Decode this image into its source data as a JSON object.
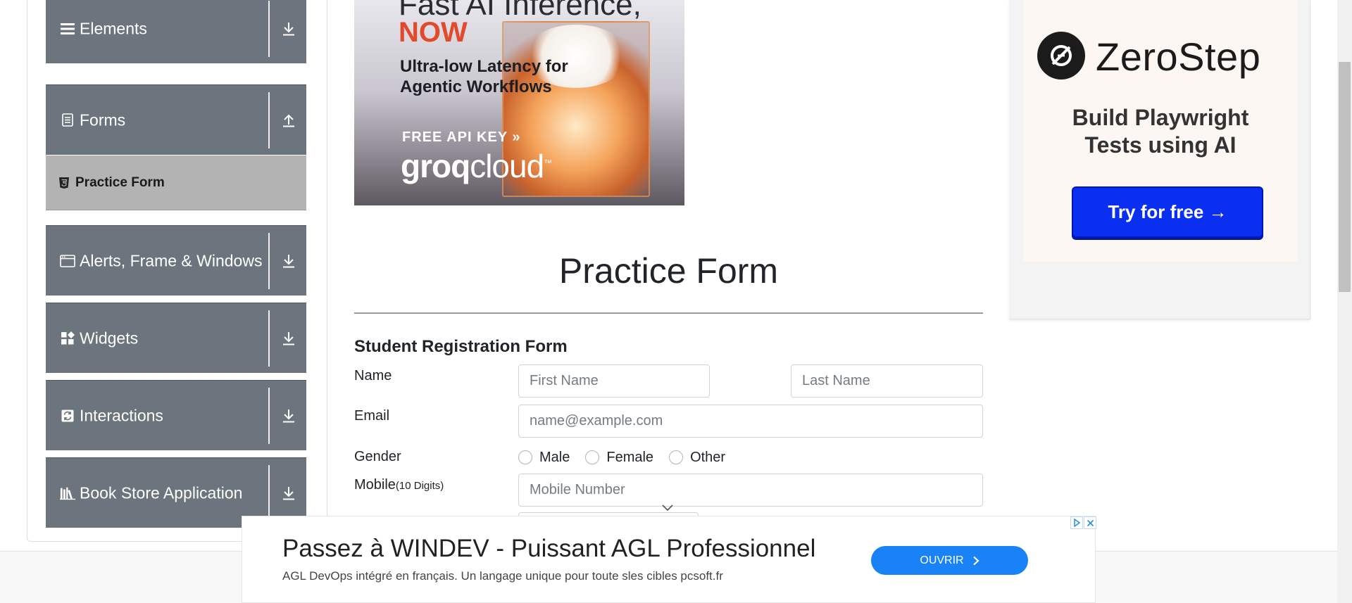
{
  "sidebar": {
    "groups": [
      {
        "label": "Elements",
        "icon": "hamburger-icon",
        "toggle_icon": "download-arrow-icon"
      },
      {
        "label": "Forms",
        "icon": "document-icon",
        "toggle_icon": "upload-arrow-icon"
      },
      {
        "label": "Alerts, Frame & Windows",
        "icon": "window-icon",
        "toggle_icon": "download-arrow-icon"
      },
      {
        "label": "Widgets",
        "icon": "widgets-icon",
        "toggle_icon": "download-arrow-icon"
      },
      {
        "label": "Interactions",
        "icon": "interactions-icon",
        "toggle_icon": "download-arrow-icon"
      },
      {
        "label": "Book Store Application",
        "icon": "books-icon",
        "toggle_icon": "download-arrow-icon"
      }
    ],
    "active_item": {
      "label": "Practice Form",
      "icon": "html5-icon"
    }
  },
  "banner_ad": {
    "line1": "Fast AI Inference,",
    "line2": "NOW",
    "subline1": "Ultra-low Latency for",
    "subline2": "Agentic Workflows",
    "cta": "FREE API KEY »",
    "brand_a": "groq",
    "brand_b": "cloud",
    "brand_tm": "™"
  },
  "form": {
    "title": "Practice Form",
    "subtitle": "Student Registration Form",
    "name_label": "Name",
    "first_name_placeholder": "First Name",
    "last_name_placeholder": "Last Name",
    "email_label": "Email",
    "email_placeholder": "name@example.com",
    "gender_label": "Gender",
    "gender_options": [
      "Male",
      "Female",
      "Other"
    ],
    "mobile_label": "Mobile",
    "mobile_hint": "(10 Digits)",
    "mobile_placeholder": "Mobile Number"
  },
  "right_ad": {
    "brand": "ZeroStep",
    "tagline1": "Build Playwright",
    "tagline2": "Tests using AI",
    "cta": "Try for free →"
  },
  "bottom_ad": {
    "headline": "Passez à WINDEV - Puissant AGL Professionnel",
    "description": "AGL DevOps intégré en français. Un langage unique pour toute sles cibles pcsoft.fr",
    "button": "OUVRIR"
  },
  "colors": {
    "sidebar_group": "#6c757d",
    "sidebar_active": "#b3b3b3",
    "right_ad_button": "#0a2ff0",
    "bottom_ad_button": "#1a82f7",
    "banner_accent": "#e24a2c"
  }
}
